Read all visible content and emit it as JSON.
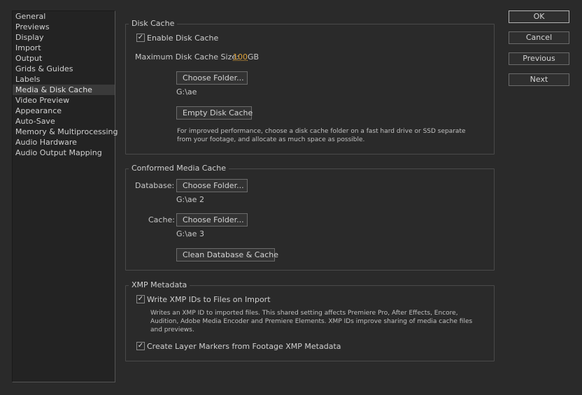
{
  "sidebar": {
    "items": [
      {
        "label": "General"
      },
      {
        "label": "Previews"
      },
      {
        "label": "Display"
      },
      {
        "label": "Import"
      },
      {
        "label": "Output"
      },
      {
        "label": "Grids & Guides"
      },
      {
        "label": "Labels"
      },
      {
        "label": "Media & Disk Cache",
        "selected": true
      },
      {
        "label": "Video Preview"
      },
      {
        "label": "Appearance"
      },
      {
        "label": "Auto-Save"
      },
      {
        "label": "Memory & Multiprocessing"
      },
      {
        "label": "Audio Hardware"
      },
      {
        "label": "Audio Output Mapping"
      }
    ]
  },
  "disk_cache": {
    "title": "Disk Cache",
    "enable_label": "Enable Disk Cache",
    "enable_checked": true,
    "max_size_label": "Maximum Disk Cache Size:",
    "max_size_value": "100",
    "max_size_unit": "GB",
    "choose_folder_label": "Choose Folder...",
    "folder_path": "G:\\ae",
    "empty_label": "Empty Disk Cache",
    "note_line1": "For improved performance, choose a disk cache folder on a fast hard drive or SSD separate",
    "note_line2": "from your footage, and allocate as much space as possible."
  },
  "conformed_cache": {
    "title": "Conformed Media Cache",
    "database_label": "Database:",
    "database_button": "Choose Folder...",
    "database_path": "G:\\ae 2",
    "cache_label": "Cache:",
    "cache_button": "Choose Folder...",
    "cache_path": "G:\\ae 3",
    "clean_label": "Clean Database & Cache"
  },
  "xmp": {
    "title": "XMP Metadata",
    "write_label": "Write XMP IDs to Files on Import",
    "write_checked": true,
    "note_line1": "Writes an XMP ID to imported files. This shared setting affects Premiere Pro, After Effects, Encore,",
    "note_line2": "Audition, Adobe Media Encoder and Premiere Elements. XMP IDs improve sharing of media cache files",
    "note_line3": "and previews.",
    "layer_markers_label": "Create Layer Markers from Footage XMP Metadata",
    "layer_markers_checked": true
  },
  "buttons": {
    "ok": "OK",
    "cancel": "Cancel",
    "previous": "Previous",
    "next": "Next"
  },
  "icons": {
    "checkmark": "checkmark-icon"
  },
  "colors": {
    "background": "#2a2a2a",
    "value_accent": "#e0a33a"
  }
}
